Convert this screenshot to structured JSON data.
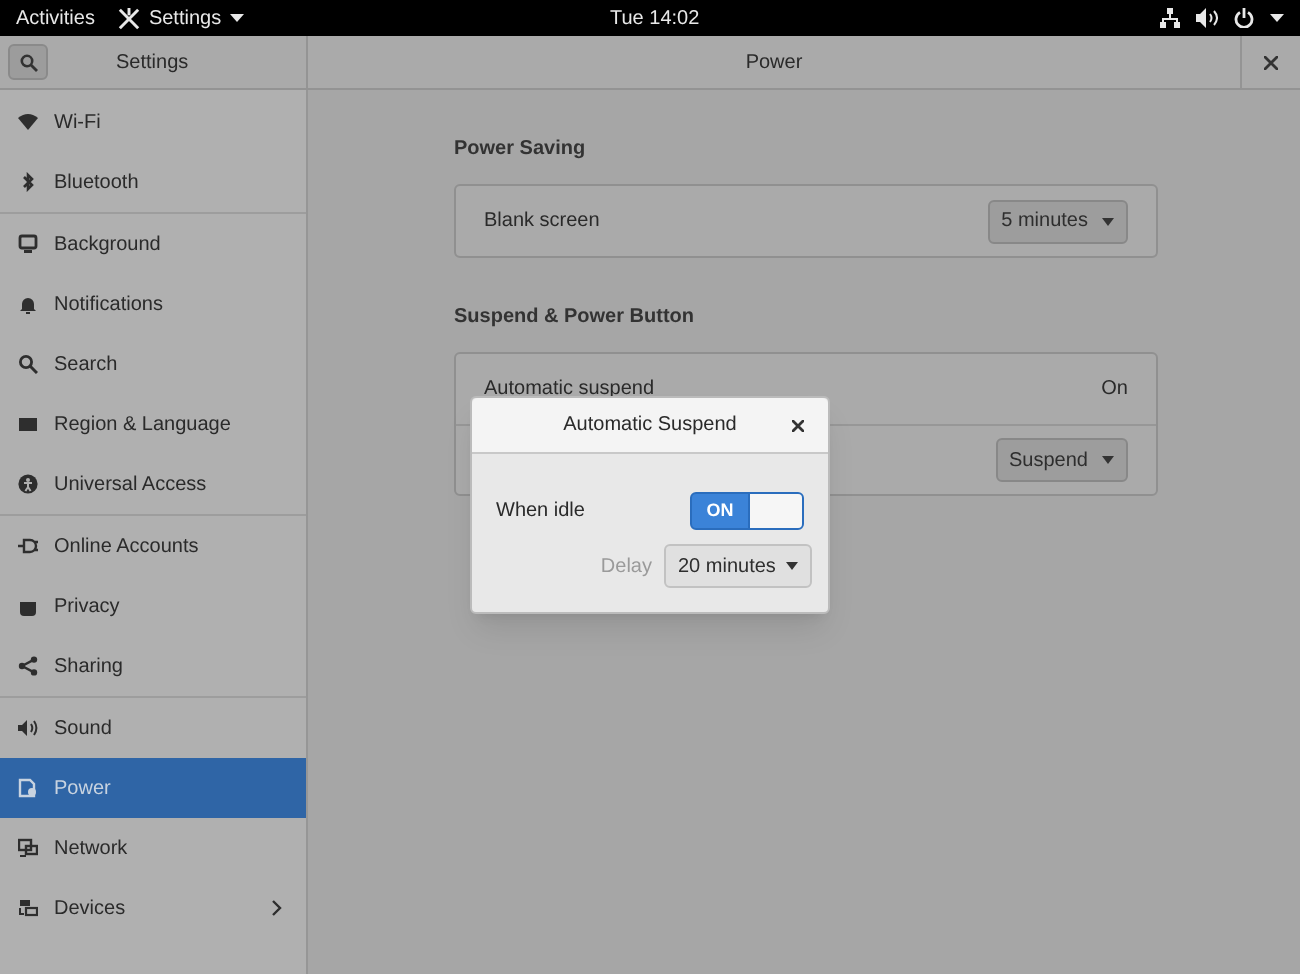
{
  "top_bar": {
    "activities": "Activities",
    "app_menu": "Settings",
    "clock": "Tue 14:02"
  },
  "header": {
    "sidebar_title": "Settings",
    "title": "Power"
  },
  "sidebar": {
    "groups": [
      [
        {
          "label": "Wi-Fi",
          "selected": false,
          "submenu": false
        },
        {
          "label": "Bluetooth",
          "selected": false,
          "submenu": false
        }
      ],
      [
        {
          "label": "Background",
          "selected": false,
          "submenu": false
        },
        {
          "label": "Notifications",
          "selected": false,
          "submenu": false
        },
        {
          "label": "Search",
          "selected": false,
          "submenu": false
        },
        {
          "label": "Region & Language",
          "selected": false,
          "submenu": false
        },
        {
          "label": "Universal Access",
          "selected": false,
          "submenu": false
        }
      ],
      [
        {
          "label": "Online Accounts",
          "selected": false,
          "submenu": false
        },
        {
          "label": "Privacy",
          "selected": false,
          "submenu": false
        },
        {
          "label": "Sharing",
          "selected": false,
          "submenu": false
        }
      ],
      [
        {
          "label": "Sound",
          "selected": false,
          "submenu": false
        },
        {
          "label": "Power",
          "selected": true,
          "submenu": false
        },
        {
          "label": "Network",
          "selected": false,
          "submenu": false
        },
        {
          "label": "Devices",
          "selected": false,
          "submenu": true
        }
      ]
    ]
  },
  "sections": [
    {
      "title": "Power Saving",
      "rows": [
        {
          "kind": "dropdown",
          "label": "Blank screen",
          "value": "5 minutes"
        }
      ]
    },
    {
      "title": "Suspend & Power Button",
      "rows": [
        {
          "kind": "text",
          "label": "Automatic suspend",
          "value": "On"
        },
        {
          "kind": "dropdown",
          "value": "Suspend"
        }
      ]
    }
  ],
  "dialog": {
    "title": "Automatic Suspend",
    "when_idle": {
      "label": "When idle",
      "on": true,
      "on_text": "ON"
    },
    "delay": {
      "label": "Delay",
      "value": "20 minutes"
    }
  }
}
